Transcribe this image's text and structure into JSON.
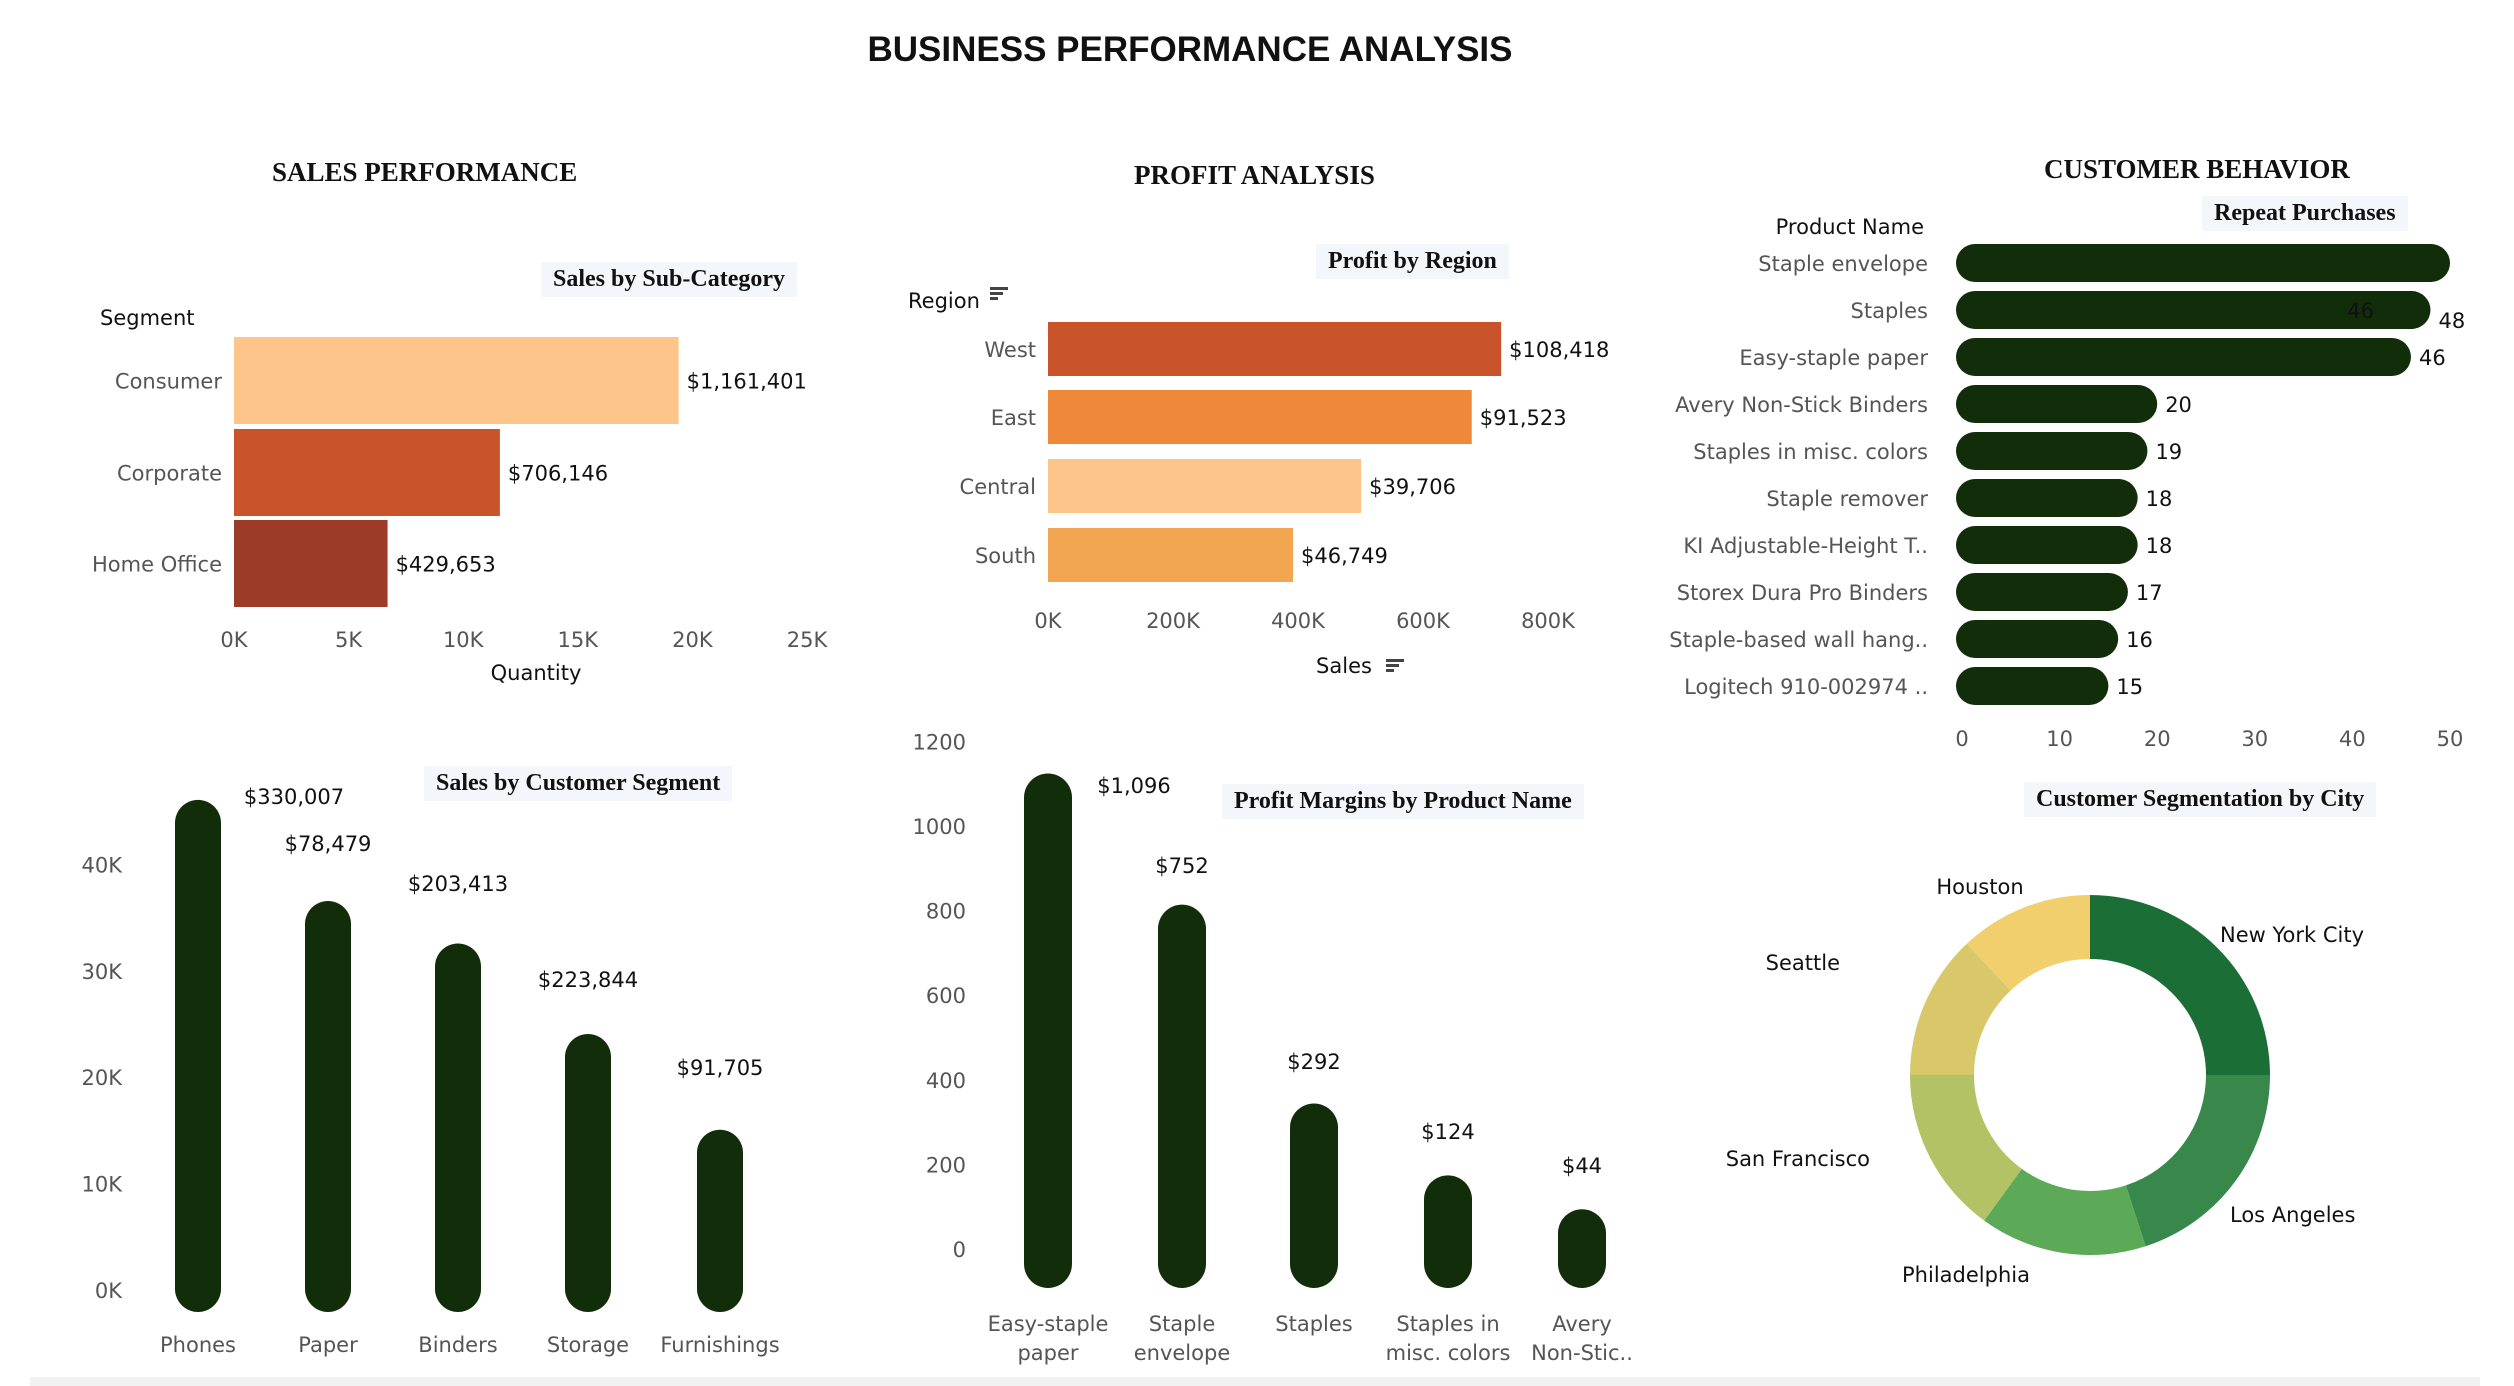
{
  "dashboard": {
    "title": "BUSINESS PERFORMANCE ANALYSIS",
    "sections": {
      "sales": "SALES PERFORMANCE",
      "profit": "PROFIT ANALYSIS",
      "customer": "CUSTOMER BEHAVIOR"
    }
  },
  "chart_data": [
    {
      "id": "sales_by_subcategory",
      "type": "bar",
      "orientation": "horizontal",
      "title": "Sales by Sub-Category",
      "ylabel": "Segment",
      "xlabel": "Quantity",
      "categories": [
        "Consumer",
        "Corporate",
        "Home Office"
      ],
      "values": [
        19400,
        11600,
        6700
      ],
      "data_labels": [
        "$1,161,401",
        "$706,146",
        "$429,653"
      ],
      "colors": [
        "#fdc58a",
        "#c9542c",
        "#9b3b28"
      ],
      "xlim": [
        0,
        25000
      ],
      "xticks": [
        "0K",
        "5K",
        "10K",
        "15K",
        "20K",
        "25K"
      ],
      "grid": false
    },
    {
      "id": "profit_by_region",
      "type": "bar",
      "orientation": "horizontal",
      "title": "Profit by Region",
      "ylabel": "Region",
      "xlabel": "Sales",
      "categories": [
        "West",
        "East",
        "Central",
        "South"
      ],
      "values": [
        725000,
        678000,
        501000,
        392000
      ],
      "data_labels": [
        "$108,418",
        "$91,523",
        "$39,706",
        "$46,749"
      ],
      "colors": [
        "#c9542c",
        "#f0883a",
        "#fdc58a",
        "#f3a652"
      ],
      "xlim": [
        0,
        850000
      ],
      "xticks": [
        "0K",
        "200K",
        "400K",
        "600K",
        "800K"
      ],
      "grid": false
    },
    {
      "id": "repeat_purchases",
      "type": "bar",
      "orientation": "horizontal",
      "title": "Repeat Purchases",
      "ylabel": "Product Name",
      "categories": [
        "Staple envelope",
        "Staples",
        "Easy-staple paper",
        "Avery Non-Stick Binders",
        "Staples in misc. colors",
        "Staple remover",
        "KI Adjustable-Height T..",
        "Storex Dura Pro Binders",
        "Staple-based wall hang..",
        "Logitech 910-002974 .."
      ],
      "values": [
        50,
        48,
        46,
        20,
        19,
        18,
        18,
        17,
        16,
        15
      ],
      "data_labels": [
        "",
        "48",
        "46",
        "20",
        "19",
        "18",
        "18",
        "17",
        "16",
        "15"
      ],
      "annotation": "46",
      "color": "#122d0a",
      "xlim": [
        0,
        50
      ],
      "xticks": [
        "0",
        "10",
        "20",
        "30",
        "40",
        "50"
      ],
      "grid": false
    },
    {
      "id": "sales_by_customer_segment",
      "type": "bar",
      "title": "Sales by Customer Segment",
      "categories": [
        "Phones",
        "Paper",
        "Binders",
        "Storage",
        "Furnishings"
      ],
      "values": [
        47000,
        37500,
        33500,
        25000,
        16000
      ],
      "data_labels": [
        "$330,007",
        "$78,479",
        "$203,413",
        "$223,844",
        "$91,705"
      ],
      "color": "#122d0a",
      "ylim": [
        0,
        50000
      ],
      "yticks": [
        "0K",
        "10K",
        "20K",
        "30K",
        "40K"
      ],
      "grid": false
    },
    {
      "id": "profit_margins_by_product",
      "type": "bar",
      "title": "Profit Margins by Product Name",
      "categories": [
        [
          "Easy-staple",
          "paper"
        ],
        [
          "Staple",
          "envelope"
        ],
        [
          "Staples"
        ],
        [
          "Staples in",
          "misc. colors"
        ],
        [
          "Avery",
          "Non-Stic.."
        ]
      ],
      "values": [
        1150,
        840,
        370,
        200,
        120
      ],
      "data_labels": [
        "$1,096",
        "$752",
        "$292",
        "$124",
        "$44"
      ],
      "color": "#122d0a",
      "ylim": [
        0,
        1200
      ],
      "yticks": [
        "0",
        "200",
        "400",
        "600",
        "800",
        "1000",
        "1200"
      ],
      "grid": false
    },
    {
      "id": "customer_segmentation_by_city",
      "type": "pie",
      "donut": true,
      "title": "Customer Segmentation by City",
      "labels": [
        "New York City",
        "Los Angeles",
        "Philadelphia",
        "San Francisco",
        "Seattle",
        "Houston"
      ],
      "values": [
        25,
        20,
        15,
        15,
        13,
        12
      ],
      "colors": [
        "#1b6e36",
        "#37884a",
        "#5caa57",
        "#b2c264",
        "#d9c869",
        "#f0cf6c"
      ]
    }
  ]
}
